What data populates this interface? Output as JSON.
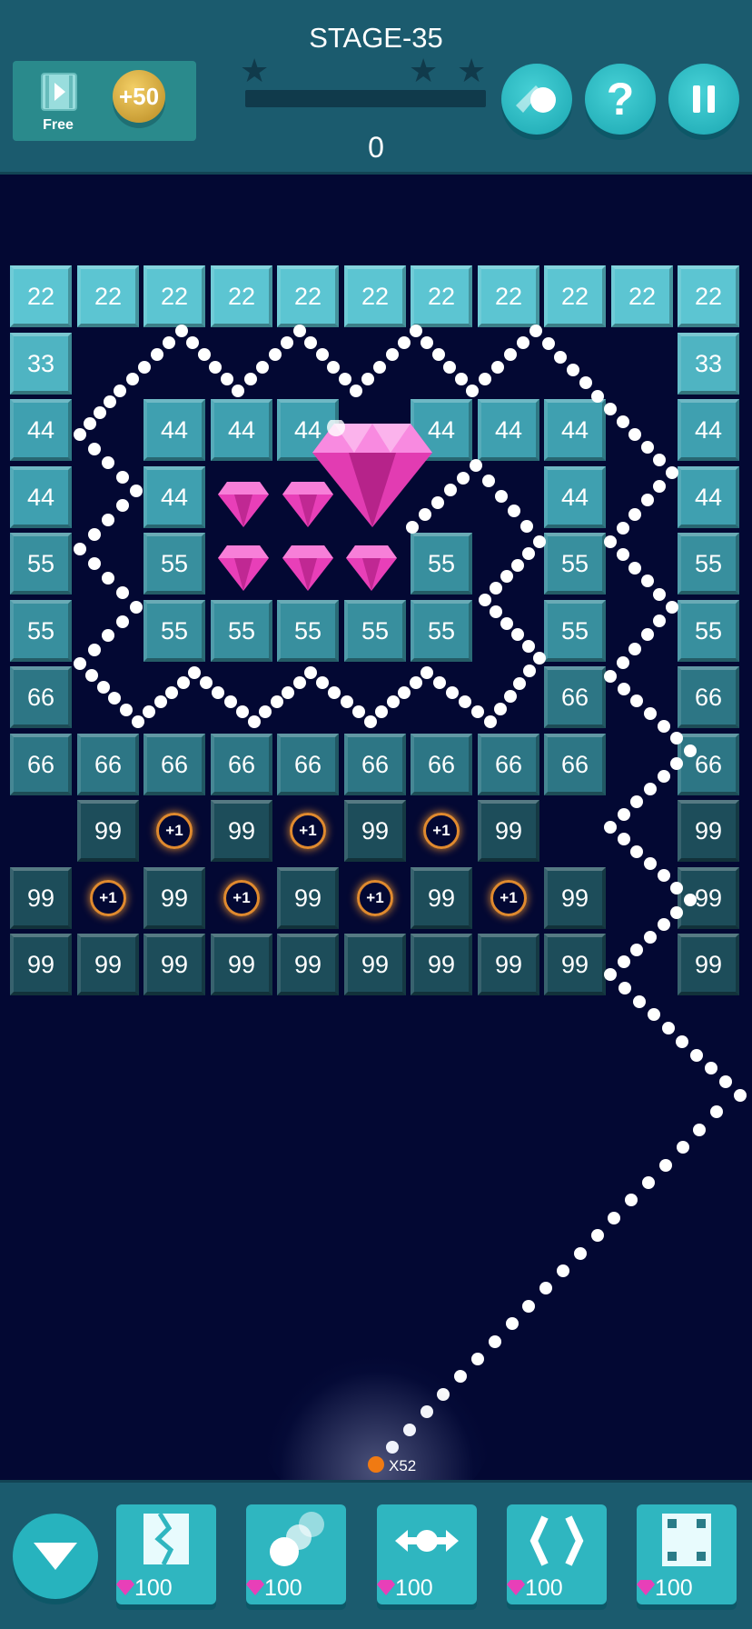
{
  "header": {
    "stage_title": "STAGE-35",
    "score": "0",
    "stars_earned": 0,
    "stars_total": 3,
    "free_video_label": "Free",
    "coin_bonus_label": "+50",
    "buttons": [
      "ball-skin-button",
      "help-button",
      "pause-button"
    ]
  },
  "board": {
    "rows": [
      [
        "22",
        "22",
        "22",
        "22",
        "22",
        "22",
        "22",
        "22",
        "22",
        "22",
        "22"
      ],
      [
        "33",
        "",
        "",
        "",
        "",
        "",
        "",
        "",
        "",
        "",
        "33"
      ],
      [
        "44",
        "",
        "44",
        "44",
        "44",
        "",
        "44",
        "44",
        "44",
        "",
        "44"
      ],
      [
        "44",
        "",
        "44",
        "",
        "",
        "",
        "",
        "",
        "44",
        "",
        "44"
      ],
      [
        "55",
        "",
        "55",
        "",
        "",
        "",
        "55",
        "",
        "55",
        "",
        "55"
      ],
      [
        "55",
        "",
        "55",
        "55",
        "55",
        "55",
        "55",
        "",
        "55",
        "",
        "55"
      ],
      [
        "66",
        "",
        "",
        "",
        "",
        "",
        "",
        "",
        "66",
        "",
        "66"
      ],
      [
        "66",
        "66",
        "66",
        "66",
        "66",
        "66",
        "66",
        "66",
        "66",
        "",
        "66"
      ],
      [
        "",
        "99",
        "+1",
        "99",
        "+1",
        "99",
        "+1",
        "99",
        "",
        "",
        "99"
      ],
      [
        "99",
        "+1",
        "99",
        "+1",
        "99",
        "+1",
        "99",
        "+1",
        "99",
        "",
        "99"
      ],
      [
        "99",
        "99",
        "99",
        "99",
        "99",
        "99",
        "99",
        "99",
        "99",
        "",
        "99"
      ]
    ],
    "colors": {
      "22": "#5cc5d2",
      "33": "#4fb4c2",
      "44": "#3fa0b0",
      "55": "#388f9e",
      "66": "#2d7685",
      "99": "#1d4d5a"
    },
    "plus_label": "+1"
  },
  "launcher": {
    "ball_count_label": "X52"
  },
  "toolbar": {
    "powerups": [
      {
        "name": "break-powerup",
        "cost": "100"
      },
      {
        "name": "multi-ball-powerup",
        "cost": "100"
      },
      {
        "name": "spread-powerup",
        "cost": "100"
      },
      {
        "name": "bounce-walls-powerup",
        "cost": "100"
      },
      {
        "name": "dice-powerup",
        "cost": "100"
      }
    ]
  }
}
